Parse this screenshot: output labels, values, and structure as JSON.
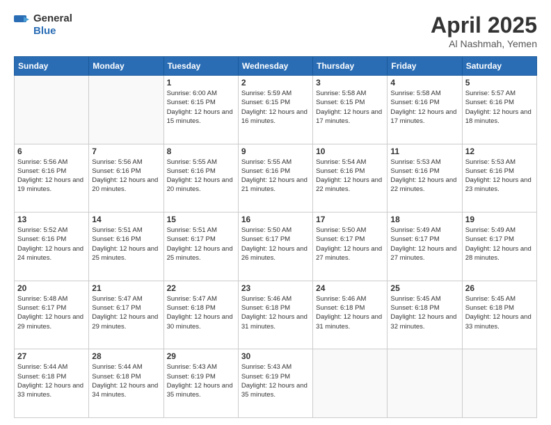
{
  "logo": {
    "general": "General",
    "blue": "Blue"
  },
  "title": "April 2025",
  "subtitle": "Al Nashmah, Yemen",
  "days_header": [
    "Sunday",
    "Monday",
    "Tuesday",
    "Wednesday",
    "Thursday",
    "Friday",
    "Saturday"
  ],
  "weeks": [
    [
      {
        "day": "",
        "info": ""
      },
      {
        "day": "",
        "info": ""
      },
      {
        "day": "1",
        "info": "Sunrise: 6:00 AM\nSunset: 6:15 PM\nDaylight: 12 hours and 15 minutes."
      },
      {
        "day": "2",
        "info": "Sunrise: 5:59 AM\nSunset: 6:15 PM\nDaylight: 12 hours and 16 minutes."
      },
      {
        "day": "3",
        "info": "Sunrise: 5:58 AM\nSunset: 6:15 PM\nDaylight: 12 hours and 17 minutes."
      },
      {
        "day": "4",
        "info": "Sunrise: 5:58 AM\nSunset: 6:16 PM\nDaylight: 12 hours and 17 minutes."
      },
      {
        "day": "5",
        "info": "Sunrise: 5:57 AM\nSunset: 6:16 PM\nDaylight: 12 hours and 18 minutes."
      }
    ],
    [
      {
        "day": "6",
        "info": "Sunrise: 5:56 AM\nSunset: 6:16 PM\nDaylight: 12 hours and 19 minutes."
      },
      {
        "day": "7",
        "info": "Sunrise: 5:56 AM\nSunset: 6:16 PM\nDaylight: 12 hours and 20 minutes."
      },
      {
        "day": "8",
        "info": "Sunrise: 5:55 AM\nSunset: 6:16 PM\nDaylight: 12 hours and 20 minutes."
      },
      {
        "day": "9",
        "info": "Sunrise: 5:55 AM\nSunset: 6:16 PM\nDaylight: 12 hours and 21 minutes."
      },
      {
        "day": "10",
        "info": "Sunrise: 5:54 AM\nSunset: 6:16 PM\nDaylight: 12 hours and 22 minutes."
      },
      {
        "day": "11",
        "info": "Sunrise: 5:53 AM\nSunset: 6:16 PM\nDaylight: 12 hours and 22 minutes."
      },
      {
        "day": "12",
        "info": "Sunrise: 5:53 AM\nSunset: 6:16 PM\nDaylight: 12 hours and 23 minutes."
      }
    ],
    [
      {
        "day": "13",
        "info": "Sunrise: 5:52 AM\nSunset: 6:16 PM\nDaylight: 12 hours and 24 minutes."
      },
      {
        "day": "14",
        "info": "Sunrise: 5:51 AM\nSunset: 6:16 PM\nDaylight: 12 hours and 25 minutes."
      },
      {
        "day": "15",
        "info": "Sunrise: 5:51 AM\nSunset: 6:17 PM\nDaylight: 12 hours and 25 minutes."
      },
      {
        "day": "16",
        "info": "Sunrise: 5:50 AM\nSunset: 6:17 PM\nDaylight: 12 hours and 26 minutes."
      },
      {
        "day": "17",
        "info": "Sunrise: 5:50 AM\nSunset: 6:17 PM\nDaylight: 12 hours and 27 minutes."
      },
      {
        "day": "18",
        "info": "Sunrise: 5:49 AM\nSunset: 6:17 PM\nDaylight: 12 hours and 27 minutes."
      },
      {
        "day": "19",
        "info": "Sunrise: 5:49 AM\nSunset: 6:17 PM\nDaylight: 12 hours and 28 minutes."
      }
    ],
    [
      {
        "day": "20",
        "info": "Sunrise: 5:48 AM\nSunset: 6:17 PM\nDaylight: 12 hours and 29 minutes."
      },
      {
        "day": "21",
        "info": "Sunrise: 5:47 AM\nSunset: 6:17 PM\nDaylight: 12 hours and 29 minutes."
      },
      {
        "day": "22",
        "info": "Sunrise: 5:47 AM\nSunset: 6:18 PM\nDaylight: 12 hours and 30 minutes."
      },
      {
        "day": "23",
        "info": "Sunrise: 5:46 AM\nSunset: 6:18 PM\nDaylight: 12 hours and 31 minutes."
      },
      {
        "day": "24",
        "info": "Sunrise: 5:46 AM\nSunset: 6:18 PM\nDaylight: 12 hours and 31 minutes."
      },
      {
        "day": "25",
        "info": "Sunrise: 5:45 AM\nSunset: 6:18 PM\nDaylight: 12 hours and 32 minutes."
      },
      {
        "day": "26",
        "info": "Sunrise: 5:45 AM\nSunset: 6:18 PM\nDaylight: 12 hours and 33 minutes."
      }
    ],
    [
      {
        "day": "27",
        "info": "Sunrise: 5:44 AM\nSunset: 6:18 PM\nDaylight: 12 hours and 33 minutes."
      },
      {
        "day": "28",
        "info": "Sunrise: 5:44 AM\nSunset: 6:18 PM\nDaylight: 12 hours and 34 minutes."
      },
      {
        "day": "29",
        "info": "Sunrise: 5:43 AM\nSunset: 6:19 PM\nDaylight: 12 hours and 35 minutes."
      },
      {
        "day": "30",
        "info": "Sunrise: 5:43 AM\nSunset: 6:19 PM\nDaylight: 12 hours and 35 minutes."
      },
      {
        "day": "",
        "info": ""
      },
      {
        "day": "",
        "info": ""
      },
      {
        "day": "",
        "info": ""
      }
    ]
  ]
}
